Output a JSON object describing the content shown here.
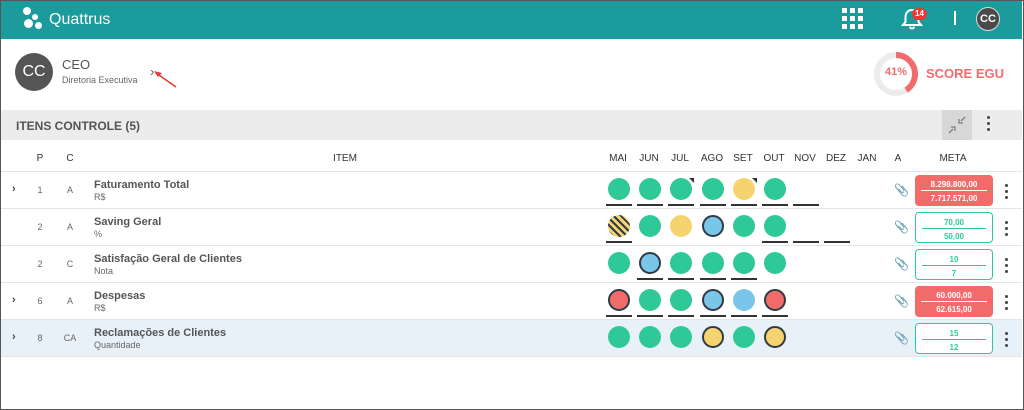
{
  "app": {
    "brand": "Quattrus",
    "notifications": "14",
    "user_initials": "CC"
  },
  "profile": {
    "initials": "CC",
    "role": "CEO",
    "department": "Diretoria Executiva"
  },
  "score": {
    "percent": "41%",
    "value": 41,
    "label": "SCORE EGU"
  },
  "section": {
    "title": "ITENS CONTROLE (5)"
  },
  "headers": {
    "p": "P",
    "c": "C",
    "item": "ITEM",
    "months": [
      "MAI",
      "JUN",
      "JUL",
      "AGO",
      "SET",
      "OUT",
      "NOV",
      "DEZ",
      "JAN"
    ],
    "a": "A",
    "meta": "META"
  },
  "colors": {
    "green": "#2fc997",
    "yellow": "#f5d470",
    "blue": "#7ac5ea",
    "red": "#f26b6b",
    "teal": "#1b9b9b"
  },
  "rows": [
    {
      "expandable": true,
      "p": "1",
      "c": "A",
      "name": "Faturamento Total",
      "unit": "R$",
      "cells": [
        {
          "status": "green",
          "border": false,
          "underline": true
        },
        {
          "status": "green",
          "border": false,
          "underline": true
        },
        {
          "status": "green",
          "border": false,
          "underline": true,
          "corner": true
        },
        {
          "status": "green",
          "border": false,
          "underline": true
        },
        {
          "status": "yellow",
          "border": false,
          "underline": true,
          "corner": true
        },
        {
          "status": "green",
          "border": false,
          "underline": true
        },
        {
          "status": "none",
          "underline": true
        },
        {
          "status": "none",
          "underline": false
        },
        {
          "status": "none",
          "underline": false
        }
      ],
      "attachment": false,
      "meta": {
        "style": "red",
        "top": "8.298.800,00",
        "bottom": "7.717.571,00"
      }
    },
    {
      "expandable": false,
      "p": "2",
      "c": "A",
      "name": "Saving Geral",
      "unit": "%",
      "cells": [
        {
          "status": "striped",
          "border": false,
          "underline": true
        },
        {
          "status": "green",
          "border": false,
          "underline": false
        },
        {
          "status": "yellow",
          "border": false,
          "underline": false
        },
        {
          "status": "blue",
          "border": true,
          "underline": false
        },
        {
          "status": "green",
          "border": false,
          "underline": false
        },
        {
          "status": "green",
          "border": false,
          "underline": true
        },
        {
          "status": "none",
          "underline": true
        },
        {
          "status": "none",
          "underline": true
        },
        {
          "status": "none",
          "underline": false
        }
      ],
      "attachment": false,
      "meta": {
        "style": "green",
        "top": "70,00",
        "bottom": "50,00"
      }
    },
    {
      "expandable": false,
      "p": "2",
      "c": "C",
      "name": "Satisfação Geral de Clientes",
      "unit": "Nota",
      "cells": [
        {
          "status": "green",
          "border": false,
          "underline": false
        },
        {
          "status": "blue",
          "border": true,
          "underline": true
        },
        {
          "status": "green",
          "border": false,
          "underline": true
        },
        {
          "status": "green",
          "border": false,
          "underline": true
        },
        {
          "status": "green",
          "border": false,
          "underline": true
        },
        {
          "status": "green",
          "border": false,
          "underline": false
        },
        {
          "status": "none",
          "underline": false
        },
        {
          "status": "none",
          "underline": false
        },
        {
          "status": "none",
          "underline": false
        }
      ],
      "attachment": true,
      "meta": {
        "style": "green",
        "top": "10",
        "bottom": "7"
      }
    },
    {
      "expandable": true,
      "p": "6",
      "c": "A",
      "name": "Despesas",
      "unit": "R$",
      "cells": [
        {
          "status": "red",
          "border": true,
          "underline": true
        },
        {
          "status": "green",
          "border": false,
          "underline": true
        },
        {
          "status": "green",
          "border": false,
          "underline": true
        },
        {
          "status": "blue",
          "border": true,
          "underline": true
        },
        {
          "status": "blue",
          "border": false,
          "underline": true
        },
        {
          "status": "red",
          "border": true,
          "underline": true
        },
        {
          "status": "none",
          "underline": false
        },
        {
          "status": "none",
          "underline": false
        },
        {
          "status": "none",
          "underline": false
        }
      ],
      "attachment": false,
      "meta": {
        "style": "red",
        "top": "60.000,00",
        "bottom": "62.615,00"
      }
    },
    {
      "expandable": true,
      "p": "8",
      "c": "CA",
      "name": "Reclamações de Clientes",
      "unit": "Quantidade",
      "cells": [
        {
          "status": "green",
          "border": false,
          "underline": false
        },
        {
          "status": "green",
          "border": false,
          "underline": false
        },
        {
          "status": "green",
          "border": false,
          "underline": false
        },
        {
          "status": "yellow",
          "border": true,
          "underline": false
        },
        {
          "status": "green",
          "border": false,
          "underline": false
        },
        {
          "status": "yellow",
          "border": true,
          "underline": false
        },
        {
          "status": "none",
          "underline": false
        },
        {
          "status": "none",
          "underline": false
        },
        {
          "status": "none",
          "underline": false
        }
      ],
      "attachment": false,
      "highlighted": true,
      "meta": {
        "style": "green",
        "top": "15",
        "bottom": "12"
      }
    }
  ]
}
